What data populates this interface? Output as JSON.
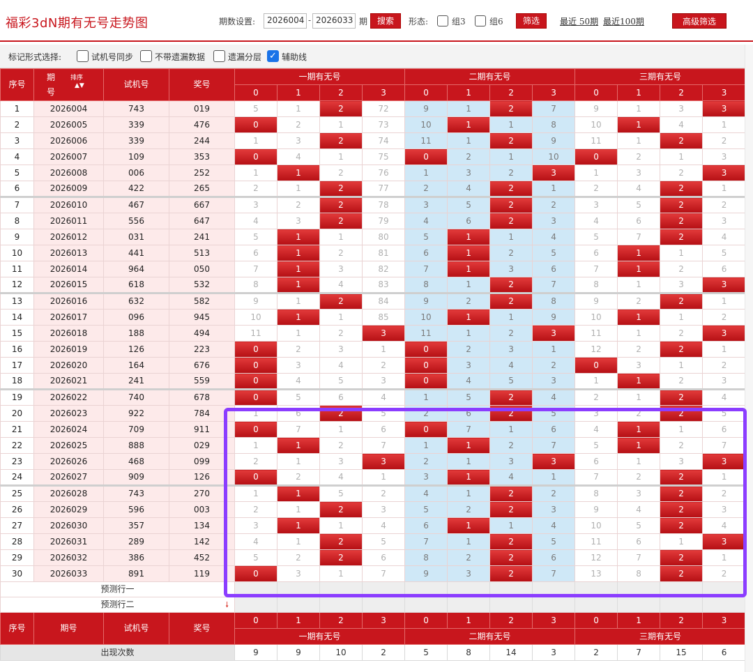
{
  "title": "福彩3dN期有无号走势图",
  "toolbar": {
    "period_label": "期数设置:",
    "from": "2026004",
    "dash": "-",
    "to": "2026033",
    "period_unit": "期",
    "search": "搜索",
    "form_label": "形态:",
    "group3": "组3",
    "group6": "组6",
    "filter": "筛选",
    "recent50": "最近 50期",
    "recent100": "最近100期",
    "advanced": "高级筛选"
  },
  "mark": {
    "label": "标记形式选择:",
    "opt1": "试机号同步",
    "opt2": "不带遗漏数据",
    "opt3": "遗漏分层",
    "opt4": "辅助线"
  },
  "header": {
    "seq": "序号",
    "issue_top": "期",
    "issue_bottom": "号",
    "sort": "排序",
    "trial": "试机号",
    "award": "奖号",
    "group1": "一期有无号",
    "group2": "二期有无号",
    "group3": "三期有无号",
    "digits": [
      "0",
      "1",
      "2",
      "3",
      "0",
      "1",
      "2",
      "3",
      "0",
      "1",
      "2",
      "3"
    ]
  },
  "rows": [
    {
      "seq": "1",
      "issue": "2026004",
      "trial": "743",
      "award": "019",
      "cells": [
        "5",
        "1",
        "2",
        "72",
        "9",
        "1",
        "2",
        "7",
        "9",
        "1",
        "3",
        "3"
      ],
      "hits": [
        2,
        6,
        11
      ]
    },
    {
      "seq": "2",
      "issue": "2026005",
      "trial": "339",
      "award": "476",
      "cells": [
        "0",
        "2",
        "1",
        "73",
        "10",
        "1",
        "1",
        "8",
        "10",
        "1",
        "4",
        "1"
      ],
      "hits": [
        0,
        5,
        9
      ]
    },
    {
      "seq": "3",
      "issue": "2026006",
      "trial": "339",
      "award": "244",
      "cells": [
        "1",
        "3",
        "2",
        "74",
        "11",
        "1",
        "2",
        "9",
        "11",
        "1",
        "2",
        "2"
      ],
      "hits": [
        2,
        6,
        10
      ]
    },
    {
      "seq": "4",
      "issue": "2026007",
      "trial": "109",
      "award": "353",
      "cells": [
        "0",
        "4",
        "1",
        "75",
        "0",
        "2",
        "1",
        "10",
        "0",
        "2",
        "1",
        "3"
      ],
      "hits": [
        0,
        4,
        8
      ]
    },
    {
      "seq": "5",
      "issue": "2026008",
      "trial": "006",
      "award": "252",
      "cells": [
        "1",
        "1",
        "2",
        "76",
        "1",
        "3",
        "2",
        "3",
        "1",
        "3",
        "2",
        "3"
      ],
      "hits": [
        1,
        7,
        11
      ]
    },
    {
      "seq": "6",
      "issue": "2026009",
      "trial": "422",
      "award": "265",
      "cells": [
        "2",
        "1",
        "2",
        "77",
        "2",
        "4",
        "2",
        "1",
        "2",
        "4",
        "2",
        "1"
      ],
      "hits": [
        2,
        6,
        10
      ]
    },
    {
      "seq": "7",
      "issue": "2026010",
      "trial": "467",
      "award": "667",
      "cells": [
        "3",
        "2",
        "2",
        "78",
        "3",
        "5",
        "2",
        "2",
        "3",
        "5",
        "2",
        "2"
      ],
      "hits": [
        2,
        6,
        10
      ]
    },
    {
      "seq": "8",
      "issue": "2026011",
      "trial": "556",
      "award": "647",
      "cells": [
        "4",
        "3",
        "2",
        "79",
        "4",
        "6",
        "2",
        "3",
        "4",
        "6",
        "2",
        "3"
      ],
      "hits": [
        2,
        6,
        10
      ]
    },
    {
      "seq": "9",
      "issue": "2026012",
      "trial": "031",
      "award": "241",
      "cells": [
        "5",
        "1",
        "1",
        "80",
        "5",
        "1",
        "1",
        "4",
        "5",
        "7",
        "2",
        "4"
      ],
      "hits": [
        1,
        5,
        10
      ]
    },
    {
      "seq": "10",
      "issue": "2026013",
      "trial": "441",
      "award": "513",
      "cells": [
        "6",
        "1",
        "2",
        "81",
        "6",
        "1",
        "2",
        "5",
        "6",
        "1",
        "1",
        "5"
      ],
      "hits": [
        1,
        5,
        9
      ]
    },
    {
      "seq": "11",
      "issue": "2026014",
      "trial": "964",
      "award": "050",
      "cells": [
        "7",
        "1",
        "3",
        "82",
        "7",
        "1",
        "3",
        "6",
        "7",
        "1",
        "2",
        "6"
      ],
      "hits": [
        1,
        5,
        9
      ]
    },
    {
      "seq": "12",
      "issue": "2026015",
      "trial": "618",
      "award": "532",
      "cells": [
        "8",
        "1",
        "4",
        "83",
        "8",
        "1",
        "2",
        "7",
        "8",
        "1",
        "3",
        "3"
      ],
      "hits": [
        1,
        6,
        11
      ]
    },
    {
      "seq": "13",
      "issue": "2026016",
      "trial": "632",
      "award": "582",
      "cells": [
        "9",
        "1",
        "2",
        "84",
        "9",
        "2",
        "2",
        "8",
        "9",
        "2",
        "2",
        "1"
      ],
      "hits": [
        2,
        6,
        10
      ]
    },
    {
      "seq": "14",
      "issue": "2026017",
      "trial": "096",
      "award": "945",
      "cells": [
        "10",
        "1",
        "1",
        "85",
        "10",
        "1",
        "1",
        "9",
        "10",
        "1",
        "1",
        "2"
      ],
      "hits": [
        1,
        5,
        9
      ]
    },
    {
      "seq": "15",
      "issue": "2026018",
      "trial": "188",
      "award": "494",
      "cells": [
        "11",
        "1",
        "2",
        "3",
        "11",
        "1",
        "2",
        "3",
        "11",
        "1",
        "2",
        "3"
      ],
      "hits": [
        3,
        7,
        11
      ]
    },
    {
      "seq": "16",
      "issue": "2026019",
      "trial": "126",
      "award": "223",
      "cells": [
        "0",
        "2",
        "3",
        "1",
        "0",
        "2",
        "3",
        "1",
        "12",
        "2",
        "2",
        "1"
      ],
      "hits": [
        0,
        4,
        10
      ]
    },
    {
      "seq": "17",
      "issue": "2026020",
      "trial": "164",
      "award": "676",
      "cells": [
        "0",
        "3",
        "4",
        "2",
        "0",
        "3",
        "4",
        "2",
        "0",
        "3",
        "1",
        "2"
      ],
      "hits": [
        0,
        4,
        8
      ]
    },
    {
      "seq": "18",
      "issue": "2026021",
      "trial": "241",
      "award": "559",
      "cells": [
        "0",
        "4",
        "5",
        "3",
        "0",
        "4",
        "5",
        "3",
        "1",
        "1",
        "2",
        "3"
      ],
      "hits": [
        0,
        4,
        9
      ]
    },
    {
      "seq": "19",
      "issue": "2026022",
      "trial": "740",
      "award": "678",
      "cells": [
        "0",
        "5",
        "6",
        "4",
        "1",
        "5",
        "2",
        "4",
        "2",
        "1",
        "2",
        "4"
      ],
      "hits": [
        0,
        6,
        10
      ]
    },
    {
      "seq": "20",
      "issue": "2026023",
      "trial": "922",
      "award": "784",
      "cells": [
        "1",
        "6",
        "2",
        "5",
        "2",
        "6",
        "2",
        "5",
        "3",
        "2",
        "2",
        "5"
      ],
      "hits": [
        2,
        6,
        10
      ]
    },
    {
      "seq": "21",
      "issue": "2026024",
      "trial": "709",
      "award": "911",
      "cells": [
        "0",
        "7",
        "1",
        "6",
        "0",
        "7",
        "1",
        "6",
        "4",
        "1",
        "1",
        "6"
      ],
      "hits": [
        0,
        4,
        9
      ]
    },
    {
      "seq": "22",
      "issue": "2026025",
      "trial": "888",
      "award": "029",
      "cells": [
        "1",
        "1",
        "2",
        "7",
        "1",
        "1",
        "2",
        "7",
        "5",
        "1",
        "2",
        "7"
      ],
      "hits": [
        1,
        5,
        9
      ]
    },
    {
      "seq": "23",
      "issue": "2026026",
      "trial": "468",
      "award": "099",
      "cells": [
        "2",
        "1",
        "3",
        "3",
        "2",
        "1",
        "3",
        "3",
        "6",
        "1",
        "3",
        "3"
      ],
      "hits": [
        3,
        7,
        11
      ]
    },
    {
      "seq": "24",
      "issue": "2026027",
      "trial": "909",
      "award": "126",
      "cells": [
        "0",
        "2",
        "4",
        "1",
        "3",
        "1",
        "4",
        "1",
        "7",
        "2",
        "2",
        "1"
      ],
      "hits": [
        0,
        5,
        10
      ]
    },
    {
      "seq": "25",
      "issue": "2026028",
      "trial": "743",
      "award": "270",
      "cells": [
        "1",
        "1",
        "5",
        "2",
        "4",
        "1",
        "2",
        "2",
        "8",
        "3",
        "2",
        "2"
      ],
      "hits": [
        1,
        6,
        10
      ]
    },
    {
      "seq": "26",
      "issue": "2026029",
      "trial": "596",
      "award": "003",
      "cells": [
        "2",
        "1",
        "2",
        "3",
        "5",
        "2",
        "2",
        "3",
        "9",
        "4",
        "2",
        "3"
      ],
      "hits": [
        2,
        6,
        10
      ]
    },
    {
      "seq": "27",
      "issue": "2026030",
      "trial": "357",
      "award": "134",
      "cells": [
        "3",
        "1",
        "1",
        "4",
        "6",
        "1",
        "1",
        "4",
        "10",
        "5",
        "2",
        "4"
      ],
      "hits": [
        1,
        5,
        10
      ]
    },
    {
      "seq": "28",
      "issue": "2026031",
      "trial": "289",
      "award": "142",
      "cells": [
        "4",
        "1",
        "2",
        "5",
        "7",
        "1",
        "2",
        "5",
        "11",
        "6",
        "1",
        "3"
      ],
      "hits": [
        2,
        6,
        11
      ]
    },
    {
      "seq": "29",
      "issue": "2026032",
      "trial": "386",
      "award": "452",
      "cells": [
        "5",
        "2",
        "2",
        "6",
        "8",
        "2",
        "2",
        "6",
        "12",
        "7",
        "2",
        "1"
      ],
      "hits": [
        2,
        6,
        10
      ]
    },
    {
      "seq": "30",
      "issue": "2026033",
      "trial": "891",
      "award": "119",
      "cells": [
        "0",
        "3",
        "1",
        "7",
        "9",
        "3",
        "2",
        "7",
        "13",
        "8",
        "2",
        "2"
      ],
      "hits": [
        0,
        6,
        10
      ]
    }
  ],
  "separators_after": [
    6,
    12,
    18,
    24
  ],
  "predict": {
    "row1": "预测行一",
    "row2": "预测行二"
  },
  "footer": {
    "seq": "序号",
    "issue": "期号",
    "trial": "试机号",
    "award": "奖号",
    "group1": "一期有无号",
    "group2": "二期有无号",
    "group3": "三期有无号",
    "digits": [
      "0",
      "1",
      "2",
      "3",
      "0",
      "1",
      "2",
      "3",
      "0",
      "1",
      "2",
      "3"
    ]
  },
  "stats": {
    "label": "出现次数",
    "values": [
      "9",
      "9",
      "10",
      "2",
      "5",
      "8",
      "14",
      "3",
      "2",
      "7",
      "15",
      "6"
    ]
  },
  "colors": {
    "accent": "#c8161d",
    "blue_band": "#cfe8f7",
    "overlay": "#8b3dff"
  }
}
